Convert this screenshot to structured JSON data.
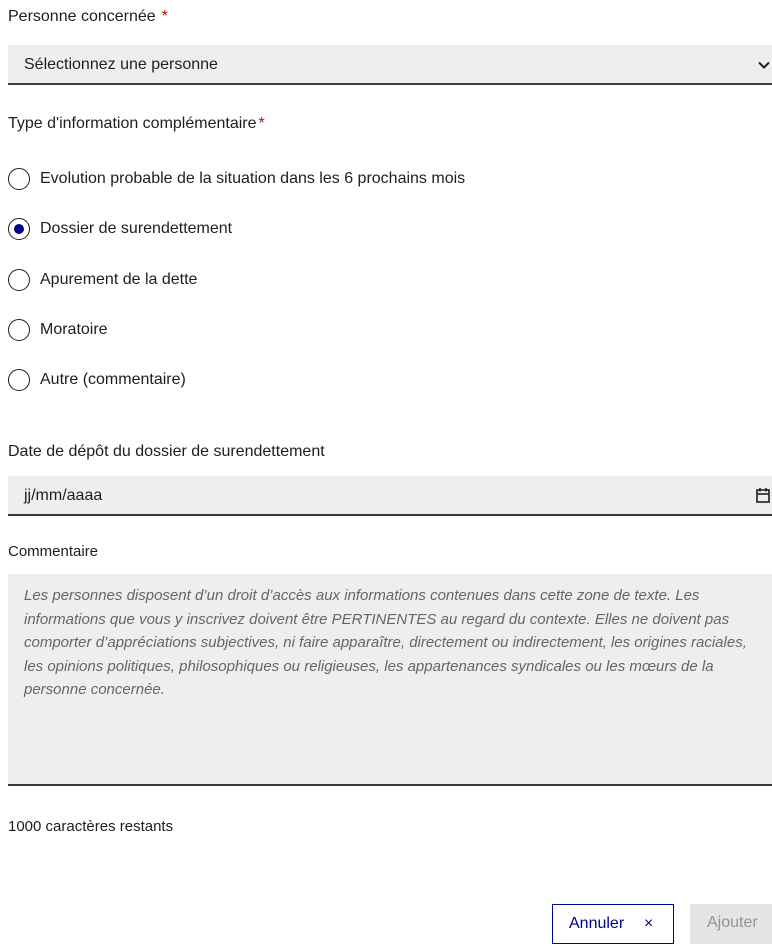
{
  "person": {
    "label": "Personne concernée",
    "required_mark": "*",
    "select_value": "Sélectionnez une personne",
    "icon": "chevron-down-icon"
  },
  "info_type": {
    "label": "Type d'information complémentaire",
    "required_mark": "*",
    "options": [
      {
        "label": "Evolution probable de la situation dans les 6 prochains mois",
        "selected": false
      },
      {
        "label": "Dossier de surendettement",
        "selected": true
      },
      {
        "label": "Apurement de la dette",
        "selected": false
      },
      {
        "label": "Moratoire",
        "selected": false
      },
      {
        "label": "Autre (commentaire)",
        "selected": false
      }
    ]
  },
  "date": {
    "label": "Date de dépôt du dossier de surendettement",
    "placeholder": "jj/mm/aaaa",
    "icon": "calendar-icon"
  },
  "comment": {
    "label": "Commentaire",
    "placeholder": "Les personnes disposent d’un droit d’accès aux informations contenues dans cette zone de texte. Les informations que vous y inscrivez doivent être PERTINENTES au regard du contexte. Elles ne doivent pas comporter d’appréciations subjectives, ni faire apparaître, directement ou indirectement, les origines raciales, les opinions politiques, philosophiques ou religieuses, les appartenances syndicales ou les mœurs de la personne concernée.",
    "remaining": "1000 caractères restants"
  },
  "actions": {
    "cancel_label": "Annuler",
    "cancel_icon_glyph": "×",
    "add_label": "Ajouter"
  },
  "colors": {
    "accent": "#000091",
    "required": "#ce0500",
    "field_bg": "#eeeeee"
  }
}
